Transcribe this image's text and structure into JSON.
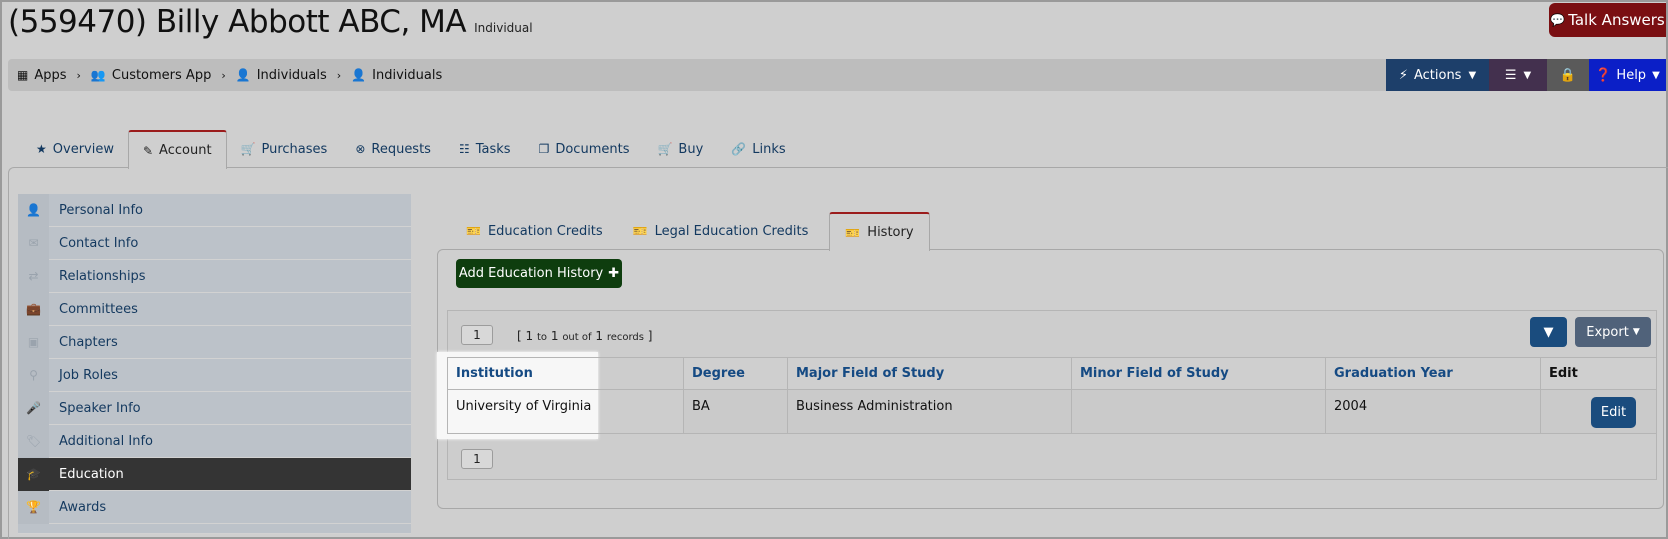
{
  "header": {
    "title": "(559470) Billy Abbott ABC, MA",
    "subtitle": "Individual",
    "talk_label": "Talk Answers"
  },
  "breadcrumb": [
    "Apps",
    "Customers App",
    "Individuals",
    "Individuals"
  ],
  "toolbar": {
    "actions_label": "Actions",
    "help_label": "Help"
  },
  "tabs": [
    "Overview",
    "Account",
    "Purchases",
    "Requests",
    "Tasks",
    "Documents",
    "Buy",
    "Links"
  ],
  "active_tab": "Account",
  "sidebar": {
    "items": [
      "Personal Info",
      "Contact Info",
      "Relationships",
      "Committees",
      "Chapters",
      "Job Roles",
      "Speaker Info",
      "Additional Info",
      "Education",
      "Awards"
    ],
    "active": "Education"
  },
  "subtabs": [
    "Education Credits",
    "Legal Education Credits",
    "History"
  ],
  "active_subtab": "History",
  "add_button": "Add Education History",
  "grid": {
    "page": "1",
    "records": {
      "from": "1",
      "to_word": "to",
      "to": "1",
      "out_of_word": "out of",
      "total": "1",
      "records_word": "records"
    },
    "export_label": "Export",
    "columns": [
      "Institution",
      "Degree",
      "Major Field of Study",
      "Minor Field of Study",
      "Graduation Year",
      "Edit"
    ],
    "rows": [
      {
        "institution": "University of Virginia",
        "degree": "BA",
        "major": "Business Administration",
        "minor": "",
        "year": "2004",
        "edit_label": "Edit"
      }
    ]
  },
  "colors": {
    "talk": "#7a0f12",
    "actions": "#1d3f6a",
    "help": "#0b1fc7",
    "add_button": "#0e3d0e",
    "sidebar_active": "#343434",
    "active_tab_top": "#9b1c1c"
  }
}
